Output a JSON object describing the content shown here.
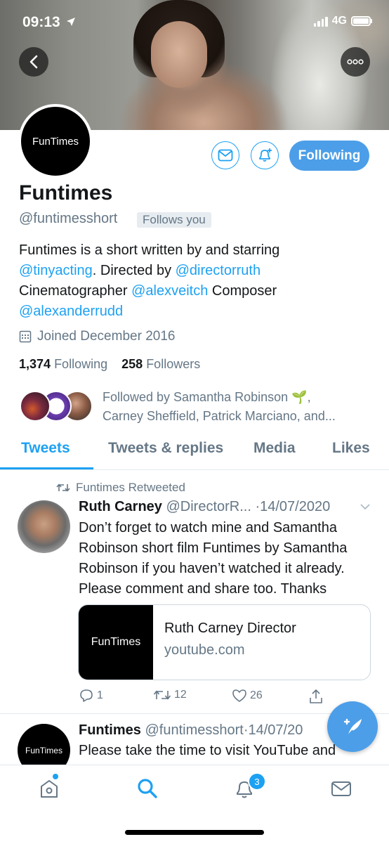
{
  "status_bar": {
    "time": "09:13",
    "network": "4G"
  },
  "profile": {
    "avatar_text": "FunTimes",
    "name": "Funtimes",
    "handle": "@funtimesshort",
    "follows_you": "Follows you",
    "following_button": "Following",
    "bio": {
      "p1": "Funtimes is a short written by and starring",
      "m1": "@tinyacting",
      "p2": ". Directed by ",
      "m2": "@directorruth",
      "p3": "Cinematographer ",
      "m3": "@alexveitch",
      "p4": " Composer",
      "m4": "@alexanderrudd"
    },
    "joined": "Joined December 2016",
    "following_count": "1,374",
    "following_label": "Following",
    "followers_count": "258",
    "followers_label": "Followers",
    "followed_by_line1": "Followed by Samantha Robinson 🌱,",
    "followed_by_line2": "Carney Sheffield, Patrick Marciano, and..."
  },
  "tabs": [
    {
      "label": "Tweets"
    },
    {
      "label": "Tweets & replies"
    },
    {
      "label": "Media"
    },
    {
      "label": "Likes"
    }
  ],
  "tweet1": {
    "retweet_label": "Funtimes Retweeted",
    "author": "Ruth Carney",
    "handle": "@DirectorR...",
    "date": "·14/07/2020",
    "text": "Don’t forget to watch mine and Samantha Robinson short film Funtimes by Samantha Robinson if you haven’t watched it already. Please comment and share too. Thanks",
    "card_thumb_text": "FunTimes",
    "card_title": "Ruth Carney Director",
    "card_domain": "youtube.com",
    "replies": "1",
    "retweets": "12",
    "likes": "26"
  },
  "tweet2": {
    "avatar_text": "FunTimes",
    "author": "Funtimes",
    "handle": "@funtimesshort",
    "date": "·14/07/20",
    "text": "Please take the time to visit YouTube and"
  },
  "nav": {
    "notifications_badge": "3"
  },
  "colors": {
    "accent": "#1da1f2",
    "following_button": "#4c9ee8",
    "muted_text": "#657786"
  }
}
